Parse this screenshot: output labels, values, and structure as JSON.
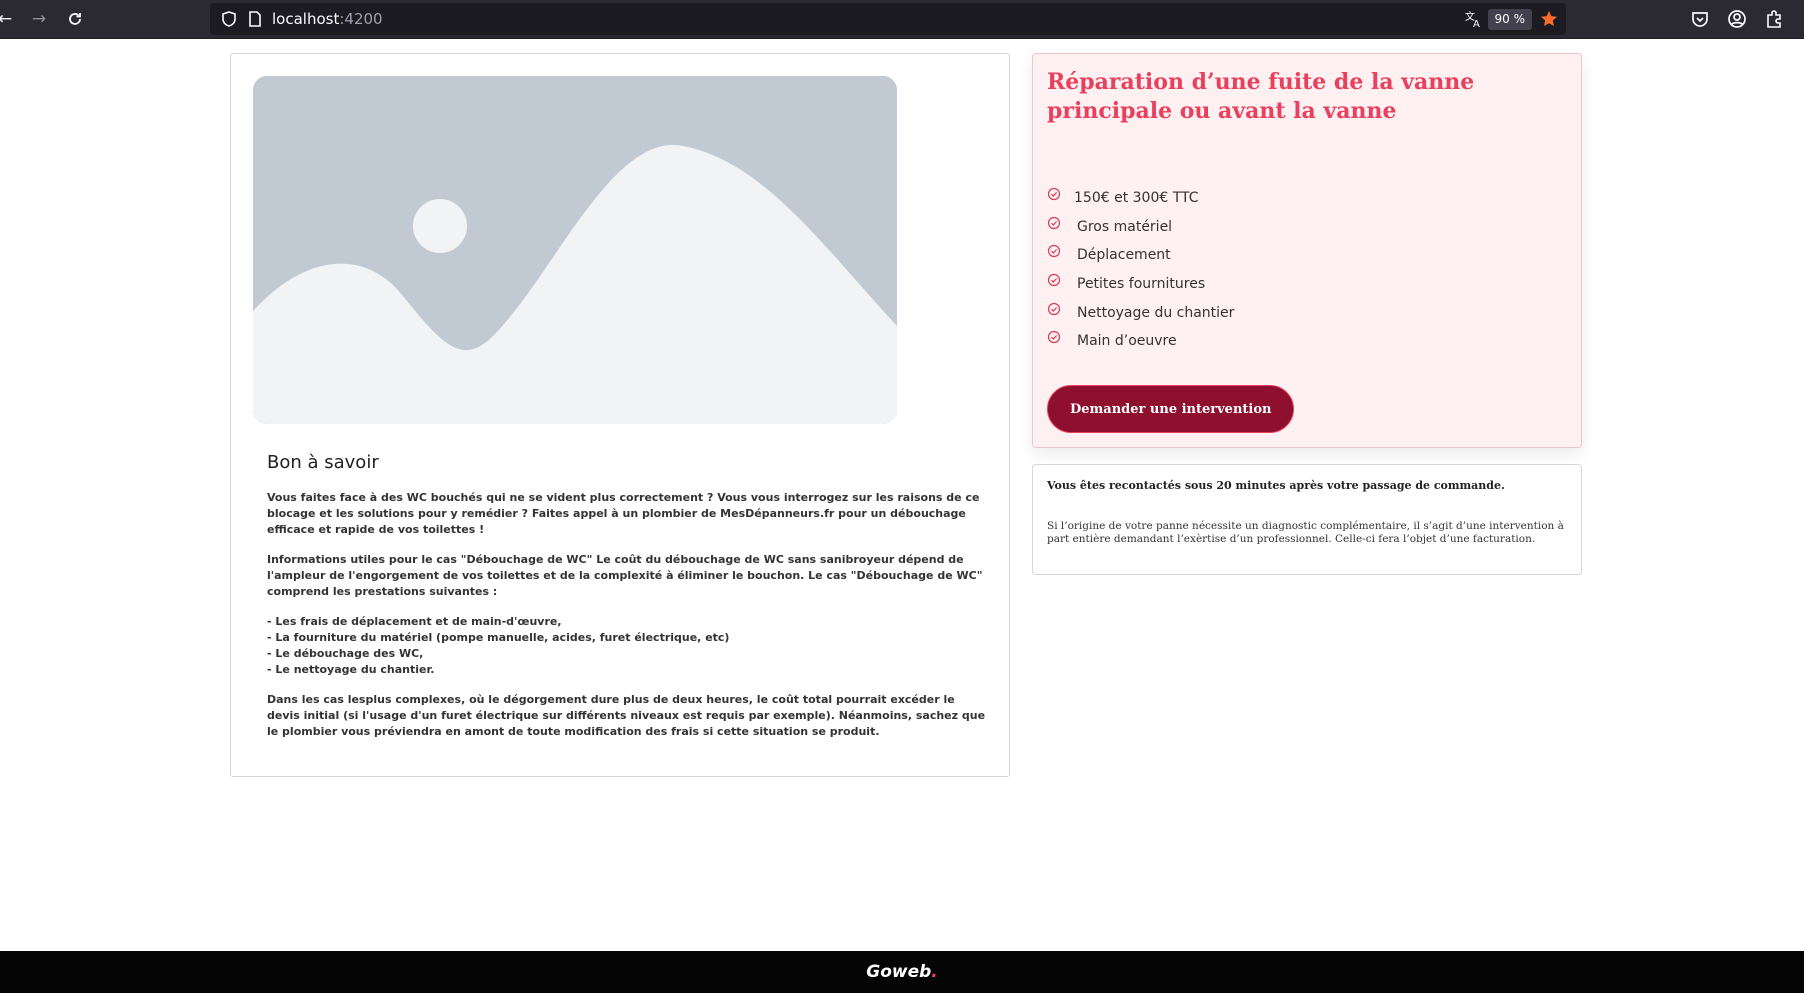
{
  "browser": {
    "url_host": "localhost",
    "url_port": ":4200",
    "zoom": "90 %"
  },
  "info": {
    "title": "Bon à savoir",
    "para1": "Vous faites face à des WC bouchés qui ne se vident plus correctement ? Vous vous interrogez sur les raisons de ce blocage et les solutions pour y remédier ? Faites appel à un plombier de MesDépanneurs.fr pour un débouchage efficace et rapide de vos toilettes !",
    "para2": "Informations utiles pour le cas \"Débouchage de WC\" Le coût du débouchage de WC sans sanibroyeur dépend de l'ampleur de l'engorgement de vos toilettes et de la complexité à éliminer le bouchon. Le cas \"Débouchage de WC\" comprend les prestations suivantes :",
    "list": [
      "- Les frais de déplacement et de main-d'œuvre,",
      "- La fourniture du matériel (pompe manuelle, acides, furet électrique, etc)",
      "- Le débouchage des WC,",
      "- Le nettoyage du chantier."
    ],
    "para3": "Dans les cas lesplus complexes, où le dégorgement dure plus de deux heures, le coût total pourrait excéder le devis initial (si l'usage d'un furet électrique sur différents niveaux est requis par exemple). Néanmoins, sachez que le plombier vous préviendra en amont de toute modification des frais si cette situation se produit."
  },
  "offer": {
    "title": "Réparation d’une fuite de la vanne principale ou avant la vanne",
    "features": [
      "150€ et 300€ TTC",
      "Gros matériel",
      "Déplacement",
      "Petites fournitures",
      "Nettoyage du chantier",
      "Main d’oeuvre"
    ],
    "button_label": "Demander une intervention",
    "accent_color": "#e8405d",
    "button_color": "#8e0f2e"
  },
  "note": {
    "headline": "Vous êtes recontactés sous 20 minutes après votre passage de commande.",
    "body": "Si l’origine de votre panne nécessite un diagnostic complémentaire, il s’agit d’une intervention à part entière demandant l’exèrtise d’un professionnel. Celle-ci fera l’objet d’une facturation."
  },
  "footer": {
    "brand": "Goweb",
    "dot": "."
  }
}
